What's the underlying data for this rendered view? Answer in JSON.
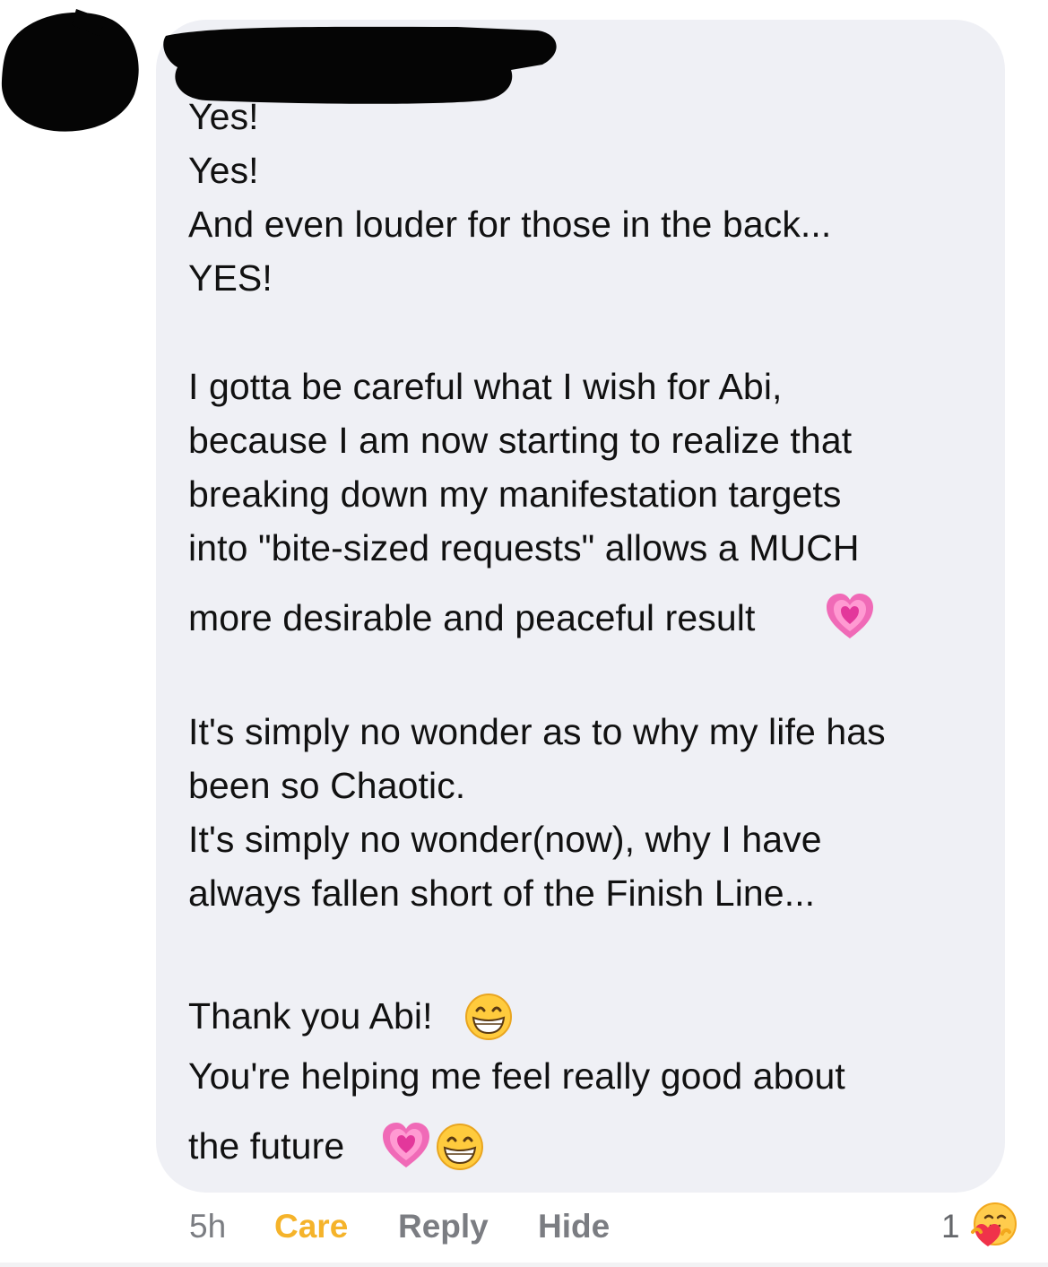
{
  "comment": {
    "author_name": "",
    "lines": [
      "Yes!",
      "Yes!",
      "And even louder for those in the back...",
      "YES!",
      "I gotta be careful what I wish for Abi,",
      "because I am now starting to realize that",
      "breaking down my manifestation targets",
      "into \"bite-sized requests\" allows a MUCH",
      "more desirable and peaceful result",
      "It's simply no wonder as to why my life has",
      "been so Chaotic.",
      "It's simply no wonder(now), why I have",
      "always fallen short of the Finish Line...",
      "Thank you Abi!",
      "You're helping me feel really good about",
      "the future"
    ],
    "emojis": [
      "growing-heart-emoji",
      "grinning-face-emoji",
      "growing-heart-emoji",
      "grinning-face-emoji"
    ]
  },
  "footer": {
    "time": "5h",
    "reaction_label": "Care",
    "reply_label": "Reply",
    "hide_label": "Hide",
    "reaction_count": "1",
    "reaction_icon": "care-reaction-icon"
  },
  "colors": {
    "bubble_bg": "#eff0f5",
    "care_color": "#f5b32a",
    "footer_gray": "#7b7d82"
  }
}
